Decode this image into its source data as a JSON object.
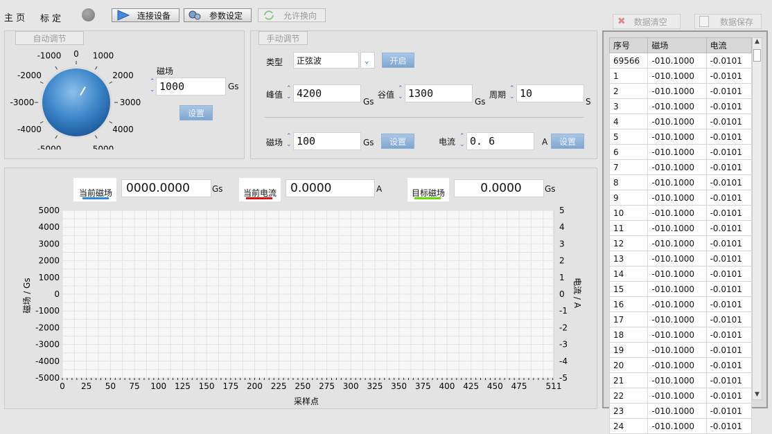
{
  "nav": {
    "home": "主 页",
    "calibrate": "标 定"
  },
  "toolbar": {
    "connect": "连接设备",
    "params": "参数设定",
    "allow_reverse": "允许换向",
    "clear": "数据清空",
    "save": "数据保存"
  },
  "auto": {
    "title": "自动调节",
    "field_label": "磁场",
    "field_value": "1000",
    "unit": "Gs",
    "set_label": "设置",
    "knob_ticks": [
      "-1000",
      "0",
      "1000",
      "2000",
      "-2000",
      "-3000",
      "3000",
      "-4000",
      "4000",
      "-5000",
      "5000"
    ],
    "knob_value": 1000
  },
  "manual": {
    "title": "手动调节",
    "type_label": "类型",
    "type_value": "正弦波",
    "open_label": "开启",
    "peak_label": "峰值",
    "peak_value": "4200",
    "peak_unit": "Gs",
    "valley_label": "谷值",
    "valley_value": "1300",
    "valley_unit": "Gs",
    "period_label": "周期",
    "period_value": "10",
    "period_unit": "S",
    "field_label": "磁场",
    "field_value": "100",
    "field_unit": "Gs",
    "field_set": "设置",
    "current_label": "电流",
    "current_value": "0. 6",
    "current_unit": "A",
    "current_set": "设置"
  },
  "readouts": [
    {
      "label": "当前磁场",
      "value": "0000.0000",
      "unit": "Gs",
      "color": "#2f86e0"
    },
    {
      "label": "当前电流",
      "value": "0.0000",
      "unit": "A",
      "color": "#e01010"
    },
    {
      "label": "目标磁场",
      "value": "0.0000",
      "unit": "Gs",
      "color": "#66dd00"
    }
  ],
  "chart_data": {
    "type": "line",
    "xlabel": "采样点",
    "ylabel": "磁场 / Gs",
    "y2label": "电流 / A",
    "xlim": [
      0,
      511
    ],
    "ylim": [
      -5000,
      5000
    ],
    "y2lim": [
      -5,
      5
    ],
    "x_ticks": [
      "0",
      "25",
      "50",
      "75",
      "100",
      "125",
      "150",
      "175",
      "200",
      "225",
      "250",
      "275",
      "300",
      "325",
      "350",
      "375",
      "400",
      "425",
      "450",
      "475",
      "511"
    ],
    "y_ticks": [
      "5000",
      "4000",
      "3000",
      "2000",
      "1000",
      "0",
      "-1000",
      "-2000",
      "-3000",
      "-4000",
      "-5000"
    ],
    "y2_ticks": [
      "5",
      "4",
      "3",
      "2",
      "1",
      "0",
      "-1",
      "-2",
      "-3",
      "-4",
      "-5"
    ],
    "grid": true,
    "series": []
  },
  "table": {
    "headers": [
      "序号",
      "磁场",
      "电流"
    ],
    "rows": [
      [
        "69566",
        "-010.1000",
        "-0.0101"
      ],
      [
        "1",
        "-010.1000",
        "-0.0101"
      ],
      [
        "2",
        "-010.1000",
        "-0.0101"
      ],
      [
        "3",
        "-010.1000",
        "-0.0101"
      ],
      [
        "4",
        "-010.1000",
        "-0.0101"
      ],
      [
        "5",
        "-010.1000",
        "-0.0101"
      ],
      [
        "6",
        "-010.1000",
        "-0.0101"
      ],
      [
        "7",
        "-010.1000",
        "-0.0101"
      ],
      [
        "8",
        "-010.1000",
        "-0.0101"
      ],
      [
        "9",
        "-010.1000",
        "-0.0101"
      ],
      [
        "10",
        "-010.1000",
        "-0.0101"
      ],
      [
        "11",
        "-010.1000",
        "-0.0101"
      ],
      [
        "12",
        "-010.1000",
        "-0.0101"
      ],
      [
        "13",
        "-010.1000",
        "-0.0101"
      ],
      [
        "14",
        "-010.1000",
        "-0.0101"
      ],
      [
        "15",
        "-010.1000",
        "-0.0101"
      ],
      [
        "16",
        "-010.1000",
        "-0.0101"
      ],
      [
        "17",
        "-010.1000",
        "-0.0101"
      ],
      [
        "18",
        "-010.1000",
        "-0.0101"
      ],
      [
        "19",
        "-010.1000",
        "-0.0101"
      ],
      [
        "20",
        "-010.1000",
        "-0.0101"
      ],
      [
        "21",
        "-010.1000",
        "-0.0101"
      ],
      [
        "22",
        "-010.1000",
        "-0.0101"
      ],
      [
        "23",
        "-010.1000",
        "-0.0101"
      ],
      [
        "24",
        "-010.1000",
        "-0.0101"
      ]
    ]
  }
}
